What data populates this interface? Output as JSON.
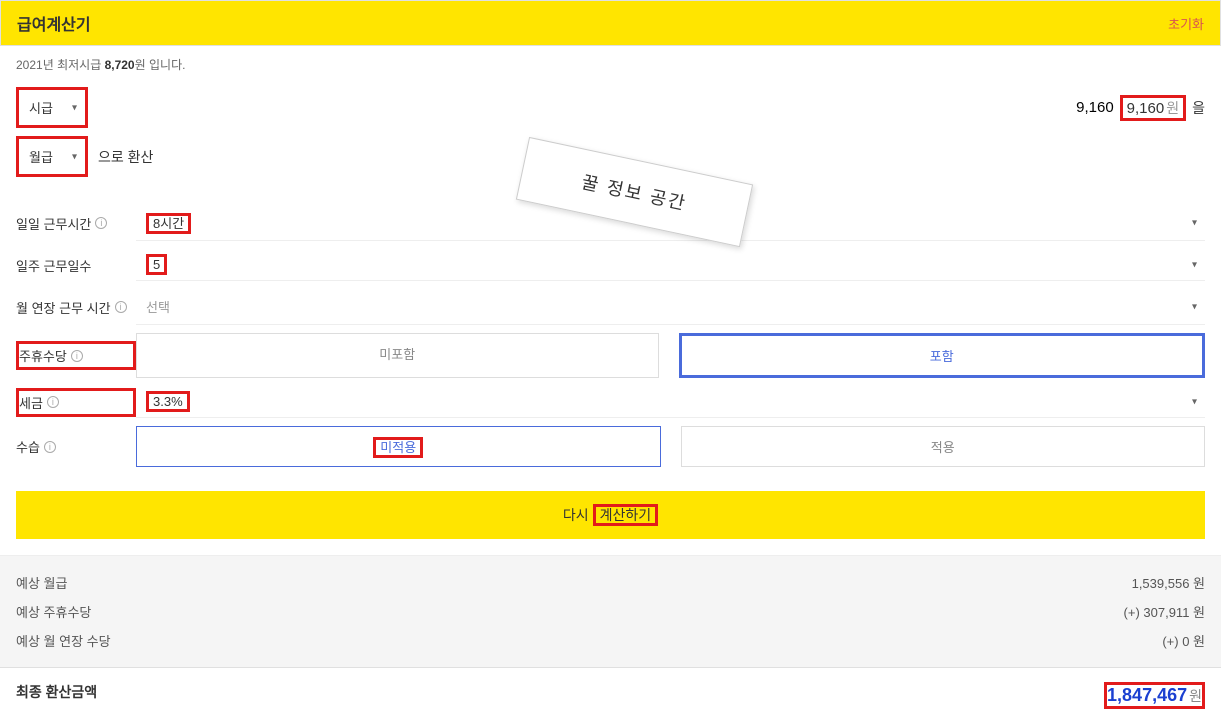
{
  "header": {
    "title": "급여계산기",
    "reset": "초기화"
  },
  "subnote": {
    "prefix": "2021년 최저시급 ",
    "amount": "8,720",
    "suffix": "원 입니다."
  },
  "payType": {
    "value": "시급"
  },
  "wage": {
    "value": "9,160",
    "unit": "원",
    "suffix": "을"
  },
  "convertTo": {
    "value": "월급",
    "suffix": "으로 환산"
  },
  "dailyHours": {
    "label": "일일 근무시간",
    "value": "8시간"
  },
  "weekDays": {
    "label": "일주 근무일수",
    "value": "5"
  },
  "overtime": {
    "label": "월 연장 근무 시간",
    "value": "선택"
  },
  "holidayPay": {
    "label": "주휴수당",
    "opt1": "미포함",
    "opt2": "포함"
  },
  "tax": {
    "label": "세금",
    "value": "3.3%"
  },
  "probation": {
    "label": "수습",
    "opt1": "미적용",
    "opt2": "적용"
  },
  "calc": {
    "prefix": "다시 ",
    "action": "계산하기"
  },
  "results": {
    "estMonthly": {
      "label": "예상 월급",
      "value": "1,539,556 원"
    },
    "estHoliday": {
      "label": "예상 주휴수당",
      "value": "(+) 307,911 원"
    },
    "estOvertime": {
      "label": "예상 월 연장 수당",
      "value": "(+) 0 원"
    }
  },
  "final": {
    "label": "최종 환산금액",
    "value": "1,847,467",
    "unit": "원"
  },
  "stamp": "꿀 정보 공간"
}
